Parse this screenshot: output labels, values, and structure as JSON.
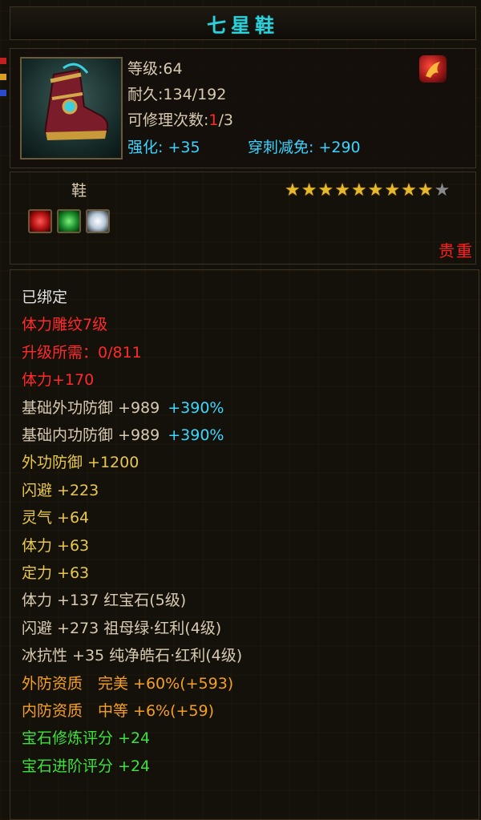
{
  "title": "七星鞋",
  "item": {
    "icon": "boots-icon",
    "level_label": "等级:64",
    "durability_label": "耐久:134/192",
    "repair_prefix": "可修理次数:",
    "repair_used": "1",
    "repair_total": "/3",
    "enhance": "强化: +35",
    "pierce": "穿刺减免: +290",
    "badge_icon": "fire-bird-icon"
  },
  "type": "鞋",
  "stars": {
    "filled": 9,
    "total": 10
  },
  "gems": [
    "red-gem-icon",
    "green-gem-icon",
    "white-gem-icon"
  ],
  "rarity": "贵重",
  "attributes": [
    {
      "text": "已绑定",
      "color": "white"
    },
    {
      "text": "体力雕纹7级",
      "color": "red"
    },
    {
      "text": "升级所需：0/811",
      "color": "red"
    },
    {
      "text": "体力+170",
      "color": "red"
    },
    {
      "text": "基础外功防御 +989",
      "color": "beige",
      "extra": "+390%"
    },
    {
      "text": "基础内功防御 +989",
      "color": "beige",
      "extra": "+390%"
    },
    {
      "text": "外功防御 +1200",
      "color": "yellow"
    },
    {
      "text": "闪避 +223",
      "color": "yellow"
    },
    {
      "text": "灵气 +64",
      "color": "yellow"
    },
    {
      "text": "体力 +63",
      "color": "yellow"
    },
    {
      "text": "定力 +63",
      "color": "yellow"
    },
    {
      "text": "体力 +137 红宝石(5级)",
      "color": "beige"
    },
    {
      "text": "闪避 +273 祖母绿·红利(4级)",
      "color": "beige"
    },
    {
      "text": "冰抗性 +35 纯净皓石·红利(4级)",
      "color": "beige"
    },
    {
      "text": "外防资质　完美 +60%(+593)",
      "color": "orange"
    },
    {
      "text": "内防资质　中等 +6%(+59)",
      "color": "orange"
    },
    {
      "text": "宝石修炼评分 +24",
      "color": "green"
    },
    {
      "text": "宝石进阶评分 +24",
      "color": "green"
    }
  ]
}
